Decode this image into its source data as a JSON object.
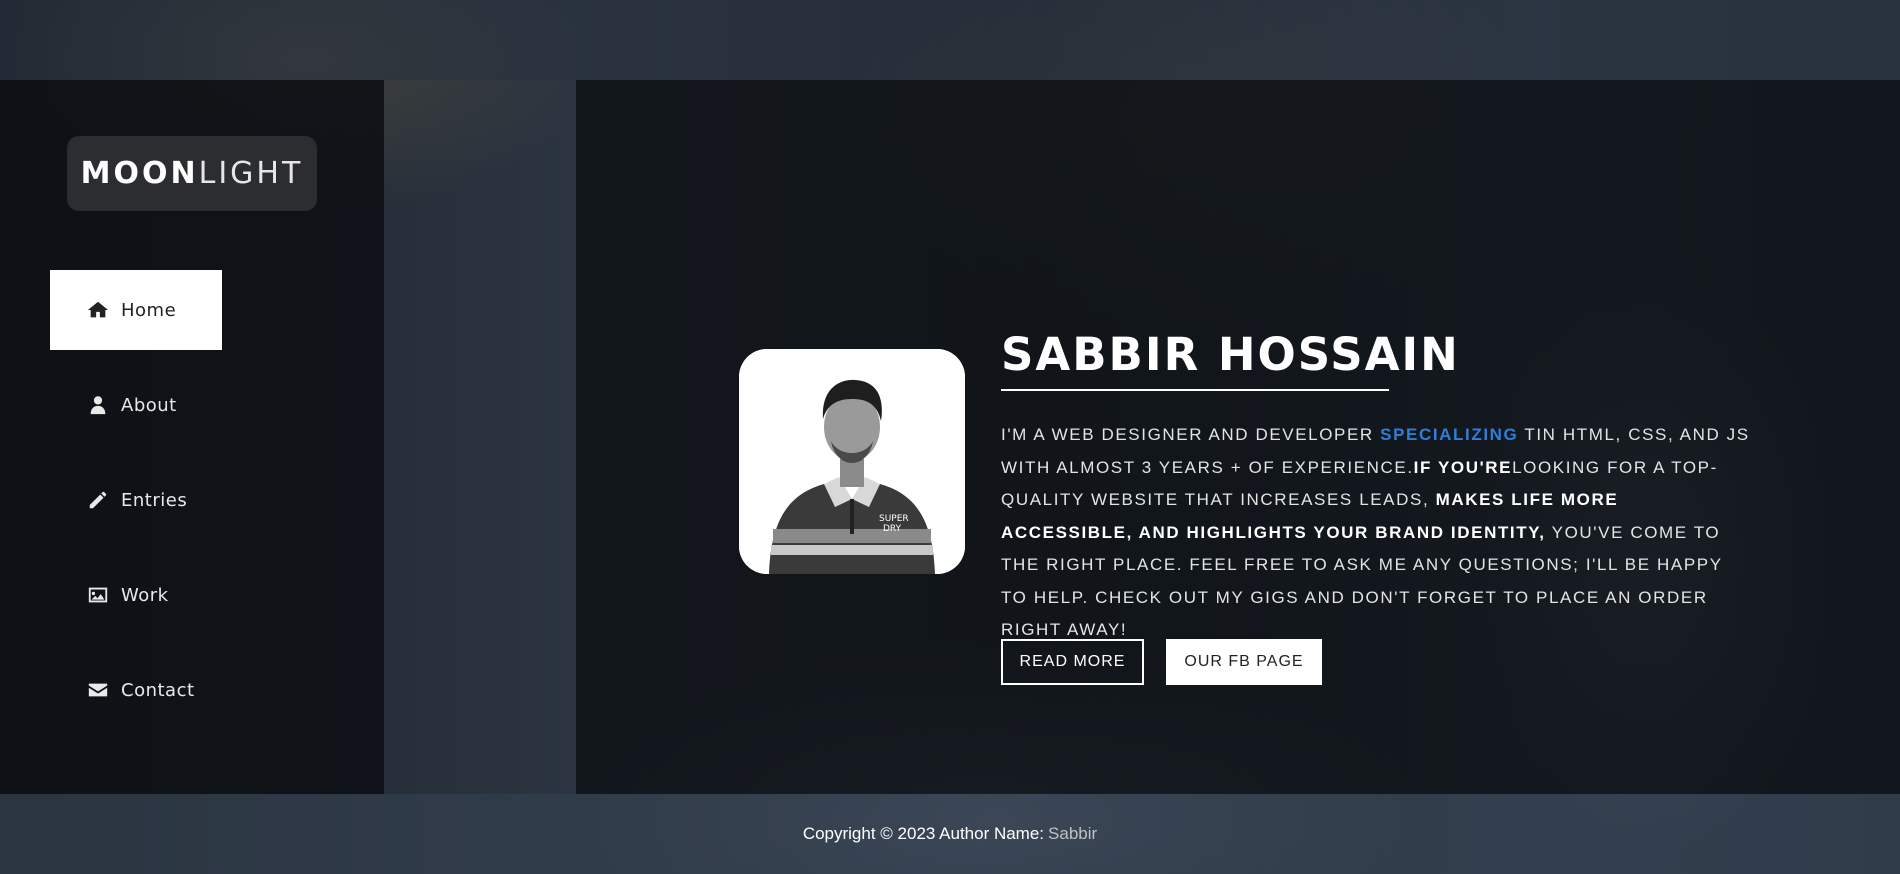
{
  "logo": {
    "bold": "MOON",
    "light": "LIGHT"
  },
  "nav": [
    {
      "label": "Home",
      "icon": "home-icon",
      "active": true
    },
    {
      "label": "About",
      "icon": "user-icon",
      "active": false
    },
    {
      "label": "Entries",
      "icon": "pencil-icon",
      "active": false
    },
    {
      "label": "Work",
      "icon": "image-icon",
      "active": false
    },
    {
      "label": "Contact",
      "icon": "envelope-icon",
      "active": false
    }
  ],
  "hero": {
    "name": "SABBIR HOSSAIN",
    "bio": {
      "p1": "I'M A WEB DESIGNER AND DEVELOPER ",
      "highlight": "SPECIALIZING",
      "p2": " TIN HTML, CSS, AND JS WITH ALMOST 3 YEARS + OF EXPERIENCE.",
      "b1": "IF YOU'RE",
      "p3": "LOOKING FOR A TOP-QUALITY WEBSITE THAT INCREASES LEADS, ",
      "b2": "MAKES LIFE MORE ACCESSIBLE, AND HIGHLIGHTS YOUR BRAND IDENTITY,",
      "p4": " YOU'VE COME TO THE RIGHT PLACE. FEEL FREE TO ASK ME ANY QUESTIONS; I'LL BE HAPPY TO HELP. CHECK OUT MY GIGS AND DON'T FORGET TO PLACE AN ORDER RIGHT AWAY!"
    },
    "read_more": "READ MORE",
    "fb_page": "OUR FB PAGE"
  },
  "footer": {
    "text": "Copyright © 2023 Author Name:",
    "name": "Sabbir"
  },
  "colors": {
    "accent": "#2f7ed8",
    "sidebar_bg": "#0c0f13",
    "active_nav_bg": "#ffffff"
  }
}
